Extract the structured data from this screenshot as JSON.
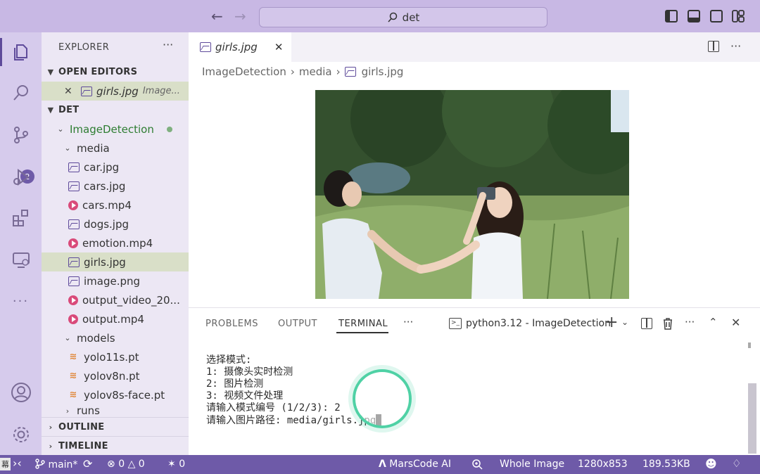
{
  "titlebar": {
    "search": "det"
  },
  "activity": {
    "scm_badge": "2"
  },
  "sidebar": {
    "title": "EXPLORER",
    "open_editors_label": "OPEN EDITORS",
    "open_editor": {
      "name": "girls.jpg",
      "path": "Image..."
    },
    "det_label": "DET",
    "folder": "ImageDetection",
    "media_folder": "media",
    "media_files": [
      {
        "name": "car.jpg",
        "type": "image"
      },
      {
        "name": "cars.jpg",
        "type": "image"
      },
      {
        "name": "cars.mp4",
        "type": "video"
      },
      {
        "name": "dogs.jpg",
        "type": "image"
      },
      {
        "name": "emotion.mp4",
        "type": "video"
      },
      {
        "name": "girls.jpg",
        "type": "image"
      },
      {
        "name": "image.png",
        "type": "image"
      },
      {
        "name": "output_video_20...",
        "type": "video"
      },
      {
        "name": "output.mp4",
        "type": "video"
      }
    ],
    "models_folder": "models",
    "model_files": [
      "yolo11s.pt",
      "yolov8n.pt",
      "yolov8s-face.pt"
    ],
    "runs_folder": "runs",
    "outline_label": "OUTLINE",
    "timeline_label": "TIMELINE"
  },
  "editor": {
    "tab_label": "girls.jpg",
    "breadcrumb": [
      "ImageDetection",
      "media",
      "girls.jpg"
    ]
  },
  "panel": {
    "tabs": [
      "PROBLEMS",
      "OUTPUT",
      "TERMINAL"
    ],
    "active_tab": "TERMINAL",
    "terminal_name": "python3.12 - ImageDetection",
    "lines": [
      "选择模式:",
      "1: 摄像头实时检测",
      "2: 图片检测",
      "3: 视频文件处理",
      "",
      "请输入模式编号 (1/2/3): 2",
      "",
      "请输入图片路径: media/girls.jpg"
    ]
  },
  "status": {
    "branch": "main*",
    "errors": "0",
    "warnings": "0",
    "ports": "0",
    "marscode": "MarsCode AI",
    "view_mode": "Whole Image",
    "dimensions": "1280x853",
    "filesize": "189.53KB",
    "left_glyph": "幕"
  },
  "colors": {
    "accent": "#6e5aa8",
    "titlebar": "#c8b8e4",
    "folder_text": "#2e7d32"
  }
}
